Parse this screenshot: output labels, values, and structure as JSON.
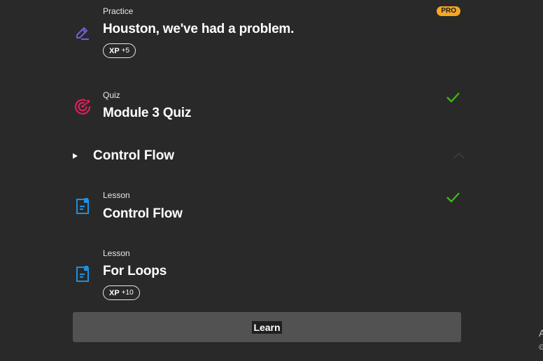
{
  "items": [
    {
      "type": "Practice",
      "title": "Houston, we've had a problem.",
      "xp_label": "XP",
      "xp_value": "+5",
      "badge": "PRO",
      "icon": "pencil-icon",
      "icon_color": "#7b5cd6"
    },
    {
      "type": "Quiz",
      "title": "Module 3 Quiz",
      "icon": "target-icon",
      "icon_color": "#e01e5a",
      "completed": true
    },
    {
      "type": "Lesson",
      "title": "Control Flow",
      "icon": "document-icon",
      "icon_color": "#1e90e0",
      "completed": true
    },
    {
      "type": "Lesson",
      "title": "For Loops",
      "xp_label": "XP",
      "xp_value": "+10",
      "icon": "document-icon",
      "icon_color": "#1e90e0"
    }
  ],
  "section": {
    "title": "Control Flow"
  },
  "learn_button": {
    "label": "Learn"
  },
  "edge": {
    "text1": "A",
    "text2": "©"
  },
  "colors": {
    "background": "#292929",
    "check": "#3fb618",
    "pro_badge": "#f5a623",
    "button": "#525252"
  }
}
